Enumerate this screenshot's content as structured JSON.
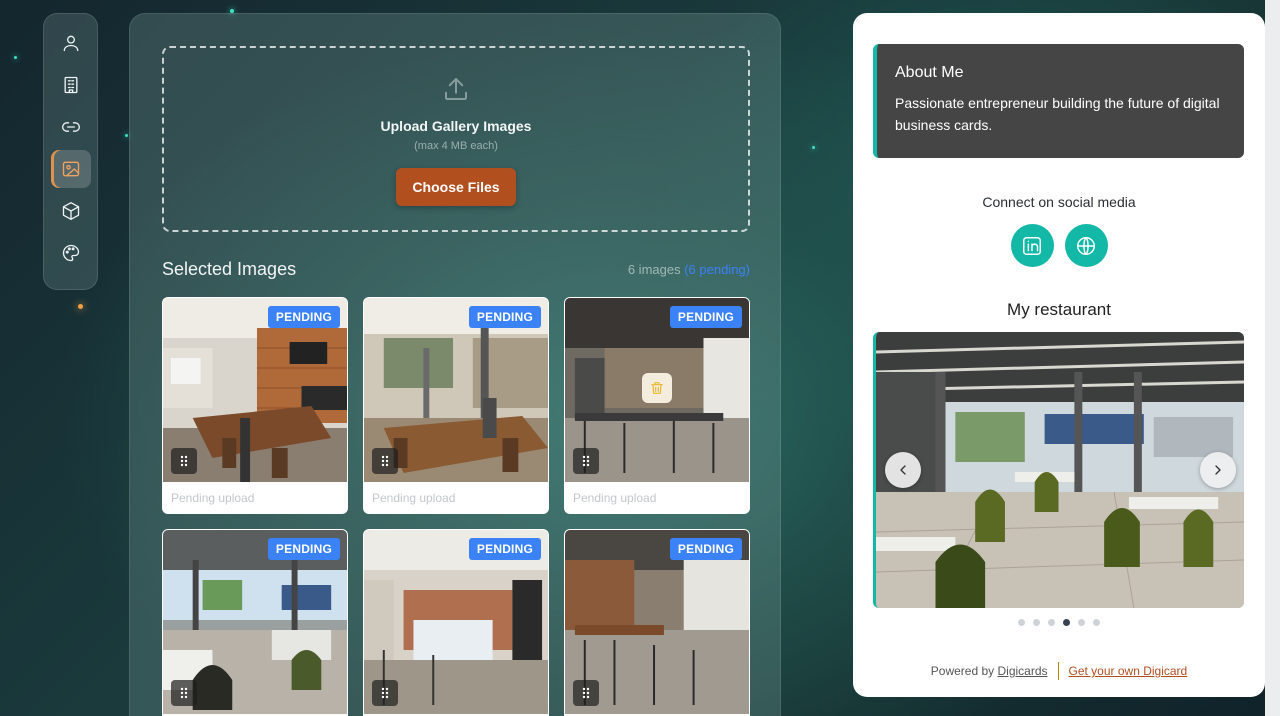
{
  "sidebar": {
    "items": [
      {
        "name": "profile",
        "icon": "user-icon",
        "active": false
      },
      {
        "name": "company",
        "icon": "building-icon",
        "active": false
      },
      {
        "name": "links",
        "icon": "link-icon",
        "active": false
      },
      {
        "name": "gallery",
        "icon": "image-icon",
        "active": true
      },
      {
        "name": "products",
        "icon": "box-icon",
        "active": false
      },
      {
        "name": "theme",
        "icon": "palette-icon",
        "active": false
      }
    ]
  },
  "upload": {
    "title": "Upload Gallery Images",
    "subtitle": "(max 4 MB each)",
    "button_label": "Choose Files",
    "icon": "upload-icon"
  },
  "selected": {
    "title": "Selected Images",
    "count_text": "6 images",
    "pending_text": "(6 pending)",
    "images": [
      {
        "badge": "PENDING",
        "caption": "Pending upload"
      },
      {
        "badge": "PENDING",
        "caption": "Pending upload"
      },
      {
        "badge": "PENDING",
        "caption": "Pending upload"
      },
      {
        "badge": "PENDING",
        "caption": ""
      },
      {
        "badge": "PENDING",
        "caption": ""
      },
      {
        "badge": "PENDING",
        "caption": ""
      }
    ]
  },
  "preview": {
    "about_title": "About Me",
    "about_text": "Passionate entrepreneur building the future of digital business cards.",
    "connect_label": "Connect on social media",
    "socials": [
      "linkedin-icon",
      "globe-icon"
    ],
    "gallery_title": "My restaurant",
    "carousel": {
      "total": 6,
      "current": 4
    },
    "footer": {
      "powered_prefix": "Powered by",
      "powered_link": "Digicards",
      "cta": "Get your own Digicard"
    }
  },
  "colors": {
    "accent": "#14b8a6",
    "button": "#b24f1f",
    "pending": "#3b82f6",
    "active_nav": "#e0914a"
  }
}
